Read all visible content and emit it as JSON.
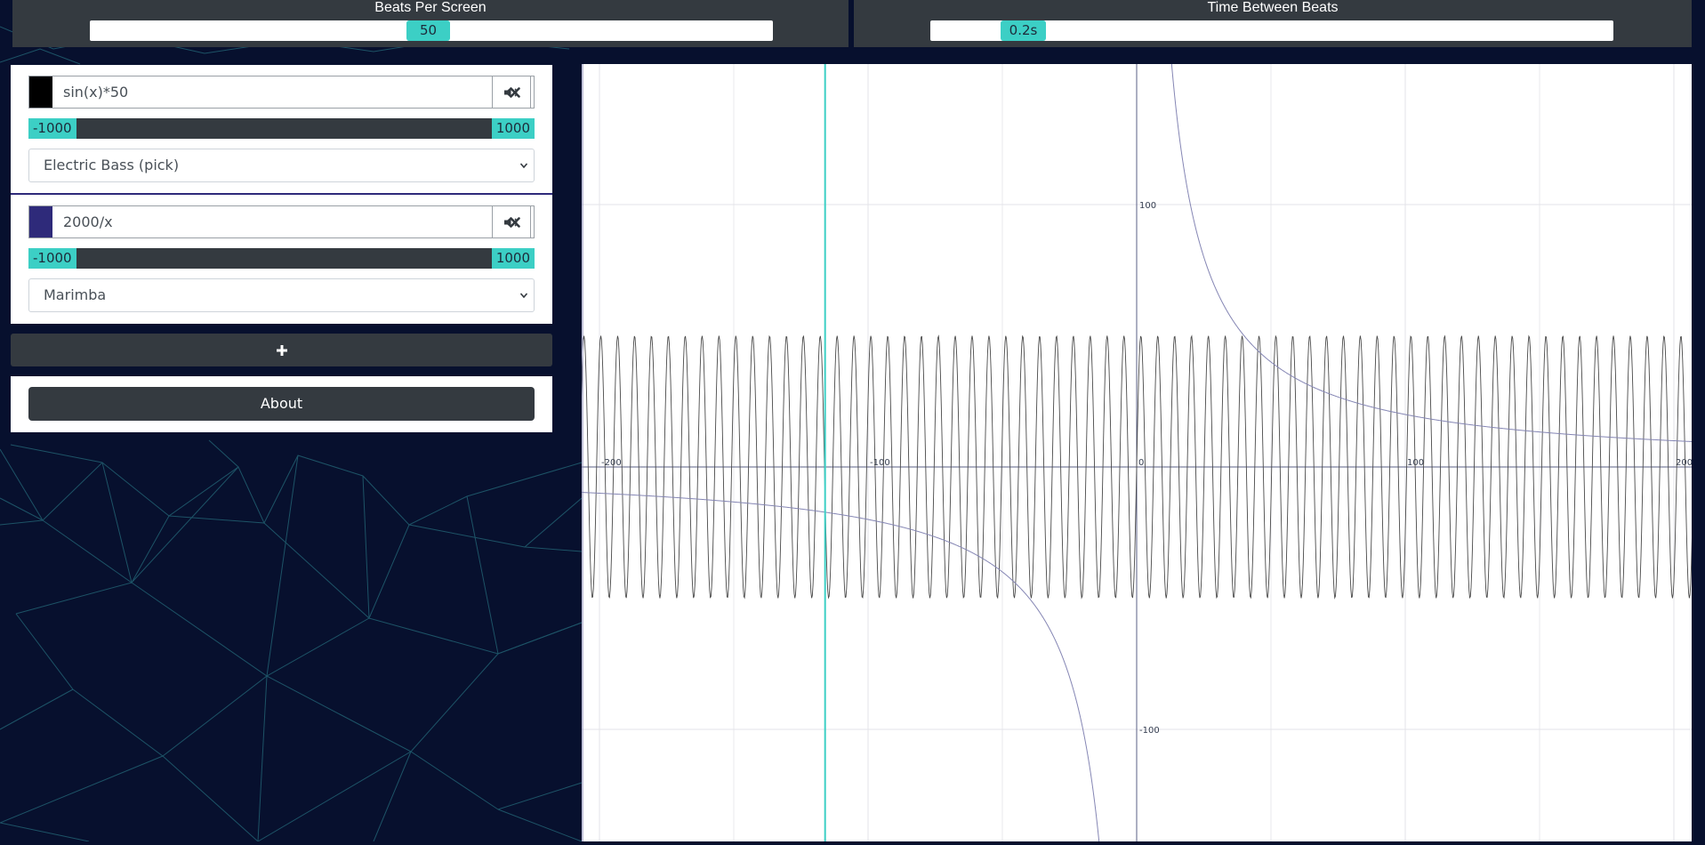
{
  "top_sliders": {
    "beats_per_screen": {
      "label": "Beats Per Screen",
      "value": "50"
    },
    "time_between_beats": {
      "label": "Time Between Beats",
      "value": "0.2s"
    }
  },
  "equations": [
    {
      "expression": "sin(x)*50",
      "color": "#000000",
      "range_min": "-1000",
      "range_max": "1000",
      "instrument": "Electric Bass (pick)"
    },
    {
      "expression": "2000/x",
      "color": "#2e2a7a",
      "range_min": "-1000",
      "range_max": "1000",
      "instrument": "Marimba"
    }
  ],
  "add_button": {
    "icon": "plus-icon"
  },
  "about_button": {
    "label": "About"
  },
  "graph": {
    "x_ticks": [
      "-200",
      "-100",
      "0",
      "100",
      "200"
    ],
    "y_ticks": [
      "100",
      "-100"
    ],
    "cursor_x": -116,
    "accent_color": "#3ccfc5"
  },
  "colors": {
    "background": "#07102e",
    "panel": "#343a40",
    "accent": "#3ccfc5"
  }
}
